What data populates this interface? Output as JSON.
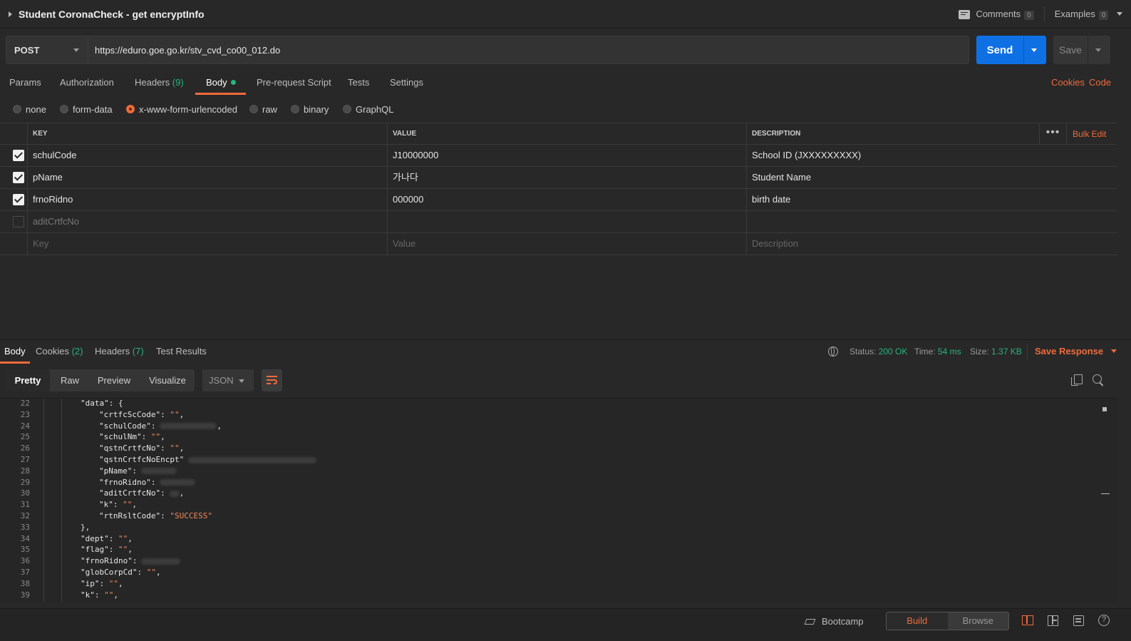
{
  "request": {
    "title": "Student CoronaCheck - get encryptInfo",
    "comments_label": "Comments",
    "comments_count": "0",
    "examples_label": "Examples",
    "examples_count": "0",
    "method": "POST",
    "url": "https://eduro.goe.go.kr/stv_cvd_co00_012.do",
    "send_label": "Send",
    "save_label": "Save"
  },
  "tabs": {
    "params": "Params",
    "authorization": "Authorization",
    "headers": "Headers",
    "headers_count": "(9)",
    "body": "Body",
    "prerequest": "Pre-request Script",
    "tests": "Tests",
    "settings": "Settings",
    "cookies_link": "Cookies",
    "code_link": "Code"
  },
  "body_types": {
    "none": "none",
    "form_data": "form-data",
    "urlencoded": "x-www-form-urlencoded",
    "raw": "raw",
    "binary": "binary",
    "graphql": "GraphQL",
    "selected": "x-www-form-urlencoded"
  },
  "params_table": {
    "headers": {
      "key": "KEY",
      "value": "VALUE",
      "description": "DESCRIPTION",
      "bulk_edit": "Bulk Edit"
    },
    "rows": [
      {
        "key": "schulCode",
        "value": "J10000000",
        "description": "School ID (JXXXXXXXXX)",
        "checked": true
      },
      {
        "key": "pName",
        "value": "가나다",
        "description": "Student Name",
        "checked": true
      },
      {
        "key": "frnoRidno",
        "value": "000000",
        "description": "birth date",
        "checked": true
      },
      {
        "key": "aditCrtfcNo",
        "value": "",
        "description": "",
        "checked": false
      }
    ],
    "placeholders": {
      "key": "Key",
      "value": "Value",
      "description": "Description"
    }
  },
  "response": {
    "tabs": {
      "body": "Body",
      "cookies": "Cookies",
      "cookies_count": "(2)",
      "headers": "Headers",
      "headers_count": "(7)",
      "test_results": "Test Results"
    },
    "status_label": "Status:",
    "status_value": "200 OK",
    "time_label": "Time:",
    "time_value": "54 ms",
    "size_label": "Size:",
    "size_value": "1.37 KB",
    "save_response": "Save Response",
    "view_modes": {
      "pretty": "Pretty",
      "raw": "Raw",
      "preview": "Preview",
      "visualize": "Visualize"
    },
    "format": "JSON",
    "code_lines": [
      {
        "n": "22",
        "indent": 1,
        "key": "\"data\"",
        "sep": ": {",
        "str": "",
        "tail": "",
        "blur": 0
      },
      {
        "n": "23",
        "indent": 2,
        "key": "\"crtfcScCode\"",
        "sep": ": ",
        "str": "\"\"",
        "tail": ",",
        "blur": 0
      },
      {
        "n": "24",
        "indent": 2,
        "key": "\"schulCode\"",
        "sep": ":",
        "str": "",
        "tail": ",",
        "blur": 80
      },
      {
        "n": "25",
        "indent": 2,
        "key": "\"schulNm\"",
        "sep": ": ",
        "str": "\"\"",
        "tail": ",",
        "blur": 0
      },
      {
        "n": "26",
        "indent": 2,
        "key": "\"qstnCrtfcNo\"",
        "sep": ": ",
        "str": "\"\"",
        "tail": ",",
        "blur": 0
      },
      {
        "n": "27",
        "indent": 2,
        "key": "\"qstnCrtfcNoEncpt\"",
        "sep": "",
        "str": "",
        "tail": "",
        "blur": 180
      },
      {
        "n": "28",
        "indent": 2,
        "key": "\"pName\"",
        "sep": ":",
        "str": "",
        "tail": "",
        "blur": 50
      },
      {
        "n": "29",
        "indent": 2,
        "key": "\"frnoRidno\"",
        "sep": ":",
        "str": "",
        "tail": "",
        "blur": 50
      },
      {
        "n": "30",
        "indent": 2,
        "key": "\"aditCrtfcNo\"",
        "sep": ":",
        "str": "",
        "tail": ",",
        "blur": 14
      },
      {
        "n": "31",
        "indent": 2,
        "key": "\"k\"",
        "sep": ": ",
        "str": "\"\"",
        "tail": ",",
        "blur": 0
      },
      {
        "n": "32",
        "indent": 2,
        "key": "\"rtnRsltCode\"",
        "sep": ": ",
        "str": "\"SUCCESS\"",
        "tail": "",
        "blur": 0
      },
      {
        "n": "33",
        "indent": 1,
        "key": "},",
        "sep": "",
        "str": "",
        "tail": "",
        "blur": 0
      },
      {
        "n": "34",
        "indent": 1,
        "key": "\"dept\"",
        "sep": ": ",
        "str": "\"\"",
        "tail": ",",
        "blur": 0
      },
      {
        "n": "35",
        "indent": 1,
        "key": "\"flag\"",
        "sep": ": ",
        "str": "\"\"",
        "tail": ",",
        "blur": 0
      },
      {
        "n": "36",
        "indent": 1,
        "key": "\"frnoRidno\"",
        "sep": ":",
        "str": "",
        "tail": "",
        "blur": 55
      },
      {
        "n": "37",
        "indent": 1,
        "key": "\"globCorpCd\"",
        "sep": ": ",
        "str": "\"\"",
        "tail": ",",
        "blur": 0
      },
      {
        "n": "38",
        "indent": 1,
        "key": "\"ip\"",
        "sep": ": ",
        "str": "\"\"",
        "tail": ",",
        "blur": 0
      },
      {
        "n": "39",
        "indent": 1,
        "key": "\"k\"",
        "sep": ": ",
        "str": "\"\"",
        "tail": ",",
        "blur": 0
      }
    ]
  },
  "statusbar": {
    "bootcamp": "Bootcamp",
    "build": "Build",
    "browse": "Browse"
  },
  "colors": {
    "accent_orange": "#ef6b3b",
    "send_blue": "#0f70e4",
    "success_green": "#26b47f",
    "background": "#282828"
  }
}
